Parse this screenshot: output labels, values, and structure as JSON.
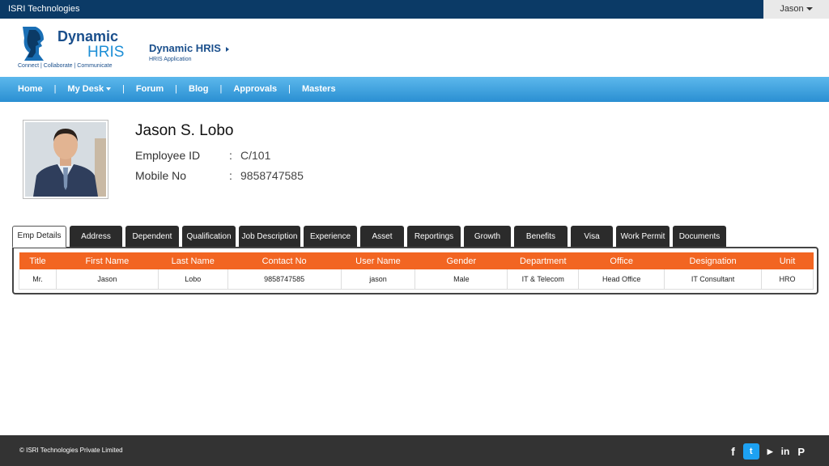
{
  "topbar": {
    "company": "ISRI Technologies",
    "user": "Jason"
  },
  "header": {
    "logo_line1": "Dynamic",
    "logo_line2": "HRIS",
    "logo_tagline": "Connect | Collaborate | Communicate",
    "app_title": "Dynamic HRIS",
    "app_subtitle": "HRIS Application"
  },
  "nav": {
    "items": [
      {
        "label": "Home"
      },
      {
        "label": "My Desk"
      },
      {
        "label": "Forum"
      },
      {
        "label": "Blog"
      },
      {
        "label": "Approvals"
      },
      {
        "label": "Masters"
      }
    ]
  },
  "profile": {
    "name": "Jason S. Lobo",
    "employee_id_label": "Employee ID",
    "employee_id": "C/101",
    "mobile_label": "Mobile No",
    "mobile": "9858747585"
  },
  "tabs": [
    {
      "label": "Emp Details"
    },
    {
      "label": "Address"
    },
    {
      "label": "Dependent"
    },
    {
      "label": "Qualification"
    },
    {
      "label": "Job Description"
    },
    {
      "label": "Experience"
    },
    {
      "label": "Asset"
    },
    {
      "label": "Reportings"
    },
    {
      "label": "Growth"
    },
    {
      "label": "Benefits"
    },
    {
      "label": "Visa"
    },
    {
      "label": "Work Permit"
    },
    {
      "label": "Documents"
    }
  ],
  "table": {
    "headers": [
      "Title",
      "First Name",
      "Last Name",
      "Contact No",
      "User Name",
      "Gender",
      "Department",
      "Office",
      "Designation",
      "Unit"
    ],
    "rows": [
      [
        "Mr.",
        "Jason",
        "Lobo",
        "9858747585",
        "jason",
        "Male",
        "IT & Telecom",
        "Head Office",
        "IT Consultant",
        "HRO"
      ]
    ]
  },
  "footer": {
    "copyright": "© ISRI Technologies Private Limited",
    "social": [
      "facebook-icon",
      "twitter-icon",
      "youtube-icon",
      "linkedin-icon",
      "pinterest-icon"
    ]
  },
  "colors": {
    "topbar": "#0b3a66",
    "nav": "#2a8fd2",
    "table_header": "#f26522",
    "footer": "#333333"
  }
}
